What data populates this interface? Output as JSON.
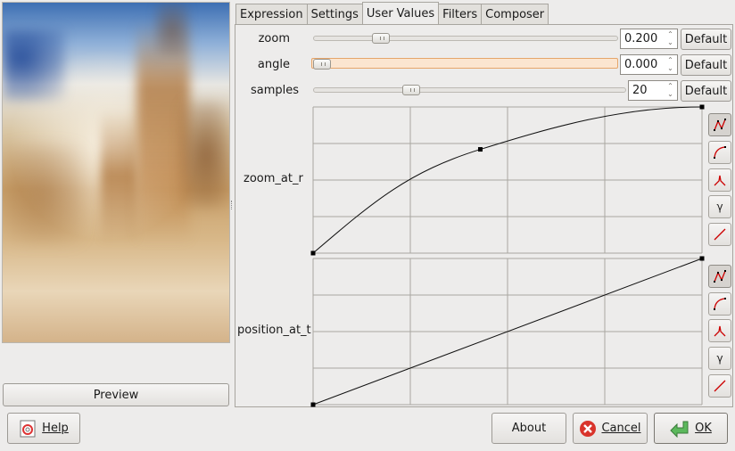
{
  "preview": {
    "button_label": "Preview"
  },
  "tabs": [
    {
      "label": "Expression",
      "active": false
    },
    {
      "label": "Settings",
      "active": false
    },
    {
      "label": "User Values",
      "active": true
    },
    {
      "label": "Filters",
      "active": false
    },
    {
      "label": "Composer",
      "active": false
    }
  ],
  "params": [
    {
      "label": "zoom",
      "value": "0.200",
      "slider_fraction": 0.2,
      "default_label": "Default"
    },
    {
      "label": "angle",
      "value": "0.000",
      "slider_fraction": 0.0,
      "default_label": "Default"
    },
    {
      "label": "samples",
      "value": "20",
      "slider_fraction": 0.3,
      "default_label": "Default"
    }
  ],
  "curves": [
    {
      "label": "zoom_at_r",
      "points": [
        [
          0,
          0
        ],
        [
          0.43,
          0.71
        ],
        [
          1,
          1
        ]
      ],
      "shape": "spline"
    },
    {
      "label": "position_at_t",
      "points": [
        [
          0,
          0
        ],
        [
          1,
          1
        ]
      ],
      "shape": "linear"
    }
  ],
  "curve_tools": [
    "spline-curve-icon",
    "ease-curve-icon",
    "peak-curve-icon",
    "gamma-icon",
    "linear-curve-icon"
  ],
  "curve_tool_gamma_glyph": "γ",
  "footer": {
    "help_label": "Help",
    "about_label": "About",
    "cancel_label": "Cancel",
    "ok_label": "OK"
  },
  "colors": {
    "accent_orange": "#e5a56a",
    "ok_green": "#5cb85c",
    "cancel_red": "#d9342b"
  }
}
